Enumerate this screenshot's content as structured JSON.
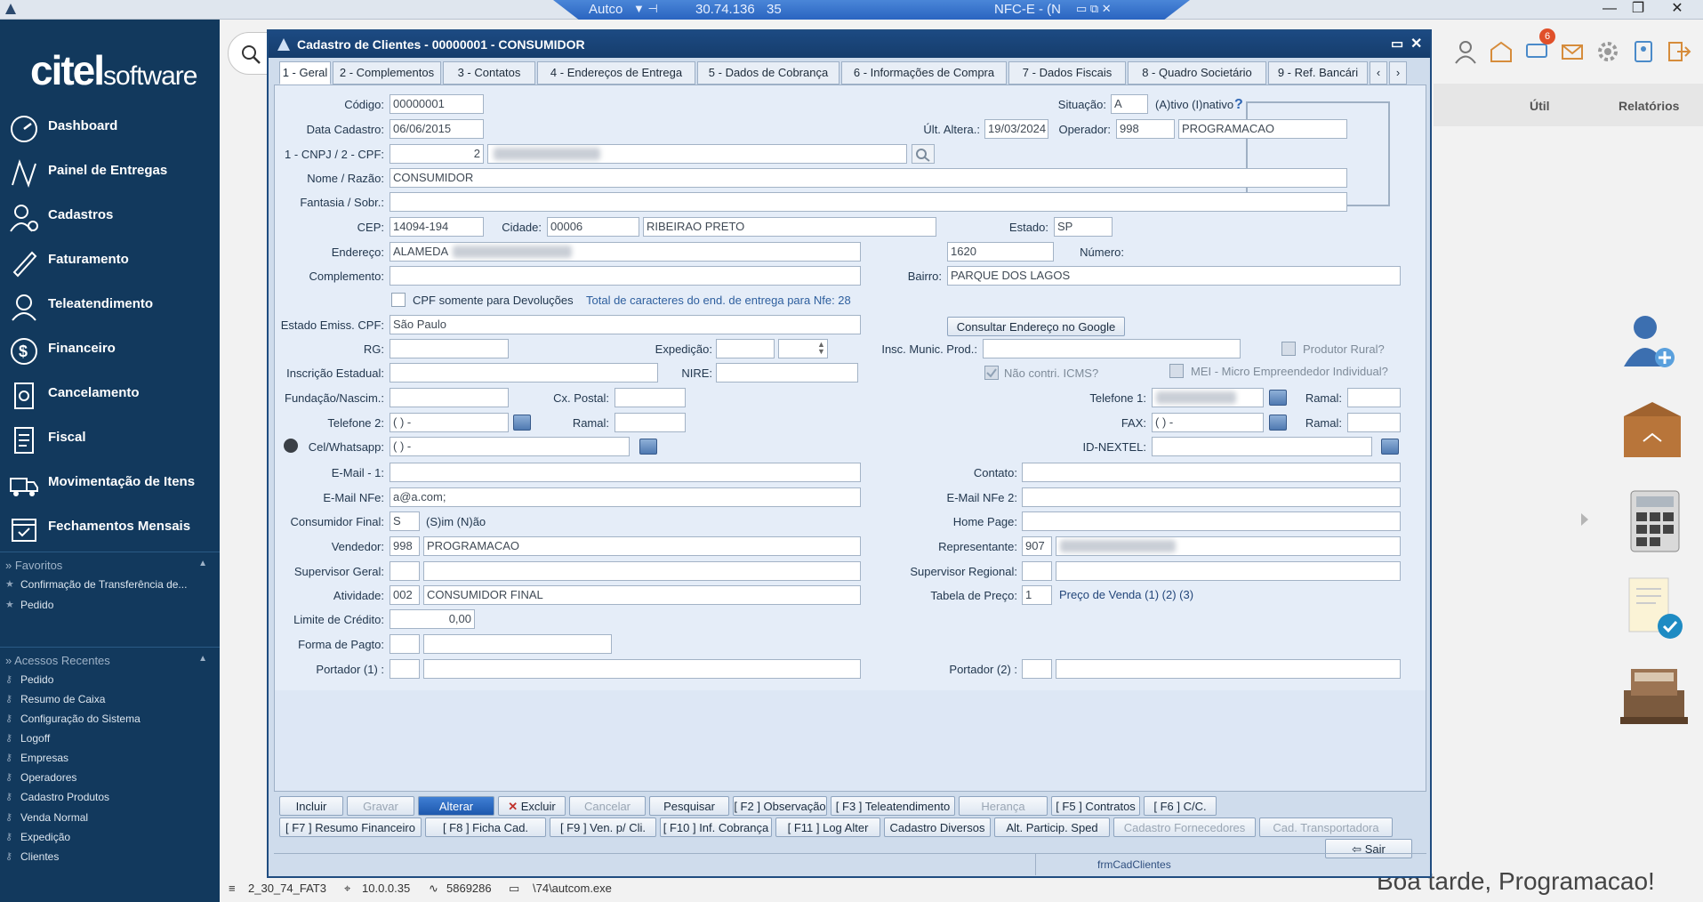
{
  "window_bar": {
    "title": "Autco",
    "ip": "30.74.136",
    "port": "35",
    "doc": "NFC-E - (N"
  },
  "sidebar": {
    "logo_main": "citel",
    "logo_sub": "software",
    "items": [
      {
        "label": "Dashboard",
        "icon": "speedometer-icon"
      },
      {
        "label": "Painel de Entregas",
        "icon": "delivery-map-icon"
      },
      {
        "label": "Cadastros",
        "icon": "user-add-icon"
      },
      {
        "label": "Faturamento",
        "icon": "pen-icon"
      },
      {
        "label": "Teleatendimento",
        "icon": "headset-icon"
      },
      {
        "label": "Financeiro",
        "icon": "dollar-icon"
      },
      {
        "label": "Cancelamento",
        "icon": "cancel-doc-icon"
      },
      {
        "label": "Fiscal",
        "icon": "document-icon"
      },
      {
        "label": "Movimentação de Itens",
        "icon": "truck-icon"
      },
      {
        "label": "Fechamentos Mensais",
        "icon": "calendar-check-icon"
      }
    ],
    "favoritos": {
      "title": "Favoritos",
      "items": [
        "Confirmação de Transferência de...",
        "Pedido"
      ]
    },
    "recentes": {
      "title": "Acessos Recentes",
      "items": [
        "Pedido",
        "Resumo de Caixa",
        "Configuração do Sistema",
        "Logoff",
        "Empresas",
        "Operadores",
        "Cadastro Produtos",
        "Venda Normal",
        "Expedição",
        "Clientes"
      ]
    }
  },
  "header": {
    "util_label": "Útil",
    "relatorios_label": "Relatórios",
    "notification_count": "6"
  },
  "greeting": "Boa tarde, Programacao!",
  "status_bar": {
    "version": "2_30_74_FAT3",
    "ip": "10.0.0.35",
    "code": "5869286",
    "exe": "\\74\\autcom.exe"
  },
  "dialog": {
    "title": "Cadastro de Clientes - 00000001 - CONSUMIDOR",
    "tabs": [
      "1 - Geral",
      "2 - Complementos",
      "3 - Contatos",
      "4 - Endereços de Entrega",
      "5 - Dados de Cobrança",
      "6 - Informações de Compra",
      "7 - Dados Fiscais",
      "8 - Quadro Societário",
      "9 - Ref. Bancári"
    ],
    "labels": {
      "codigo": "Código:",
      "data_cadastro": "Data Cadastro:",
      "cnpj_cpf": "1 - CNPJ / 2 - CPF:",
      "nome": "Nome / Razão:",
      "fantasia": "Fantasia / Sobr.:",
      "cep": "CEP:",
      "cidade": "Cidade:",
      "estado": "Estado:",
      "endereco": "Endereço:",
      "numero": "Número:",
      "complemento": "Complemento:",
      "bairro": "Bairro:",
      "cpf_devolucoes": "CPF somente para Devoluções",
      "total_caracteres": "Total de caracteres do end. de entrega para Nfe: 28",
      "estado_emiss": "Estado Emiss. CPF:",
      "rg": "RG:",
      "expedicao": "Expedição:",
      "insc_munic": "Insc. Munic. Prod.:",
      "produtor_rural": "Produtor Rural?",
      "insc_estadual": "Inscrição Estadual:",
      "nire": "NIRE:",
      "nao_contri": "Não contri. ICMS?",
      "mei": "MEI - Micro Empreendedor Individual?",
      "fundacao": "Fundação/Nascim.:",
      "cx_postal": "Cx. Postal:",
      "telefone1": "Telefone 1:",
      "ramal": "Ramal:",
      "telefone2": "Telefone 2:",
      "fax": "FAX:",
      "cel": "Cel/Whatsapp:",
      "id_nextel": "ID-NEXTEL:",
      "email1": "E-Mail - 1:",
      "contato": "Contato:",
      "email_nfe": "E-Mail NFe:",
      "email_nfe2": "E-Mail NFe 2:",
      "consumidor_final": "Consumidor Final:",
      "sim_nao": "(S)im (N)ão",
      "home_page": "Home Page:",
      "vendedor": "Vendedor:",
      "representante": "Representante:",
      "supervisor_geral": "Supervisor Geral:",
      "supervisor_regional": "Supervisor Regional:",
      "atividade": "Atividade:",
      "tabela_preco": "Tabela de Preço:",
      "preco_venda": "Preço de Venda  (1) (2) (3)",
      "limite_credito": "Limite de Crédito:",
      "forma_pagto": "Forma de Pagto:",
      "portador1": "Portador (1) :",
      "portador2": "Portador (2) :",
      "situacao": "Situação:",
      "ativo_inativo": "(A)tivo (I)nativo",
      "ult_altera": "Últ. Altera.:",
      "operador": "Operador:"
    },
    "values": {
      "codigo": "00000001",
      "data_cadastro": "06/06/2015",
      "cnpj_tipo": "2",
      "nome": "CONSUMIDOR",
      "fantasia": "",
      "cep": "14094-194",
      "cidade_cod": "00006",
      "cidade_nome": "RIBEIRAO PRETO",
      "estado": "SP",
      "endereco": "ALAMEDA",
      "numero": "1620",
      "complemento": "",
      "bairro": "PARQUE DOS LAGOS",
      "estado_emiss": "São Paulo",
      "telefone2": "(  )     -",
      "cel": "(  )     -",
      "fax": "(  )     -",
      "email_nfe": "a@a.com;",
      "consumidor_final": "S",
      "vendedor_cod": "998",
      "vendedor_nome": "PROGRAMACAO",
      "representante_cod": "907",
      "atividade_cod": "002",
      "atividade_nome": "CONSUMIDOR FINAL",
      "tabela_preco": "1",
      "limite_credito": "0,00",
      "situacao": "A",
      "ult_altera": "19/03/2024",
      "operador_cod": "998",
      "operador_nome": "PROGRAMACAO"
    },
    "consultar_btn": "Consultar Endereço no Google",
    "buttons_row1": [
      "Incluir",
      "Gravar",
      "Alterar",
      "Excluir",
      "Cancelar",
      "Pesquisar",
      "[ F2 ] Observação",
      "[ F3 ] Teleatendimento",
      "Herança",
      "[ F5 ] Contratos",
      "[ F6 ] C/C."
    ],
    "buttons_row2": [
      "[ F7 ] Resumo Financeiro",
      "[ F8 ] Ficha Cad.",
      "[ F9 ] Ven. p/ Cli.",
      "[ F10 ] Inf. Cobrança",
      "[ F11 ] Log Alter",
      "Cadastro Diversos",
      "Alt. Particip. Sped",
      "Cadastro Fornecedores",
      "Cad. Transportadora"
    ],
    "sair": "Sair",
    "form_name": "frmCadClientes"
  }
}
